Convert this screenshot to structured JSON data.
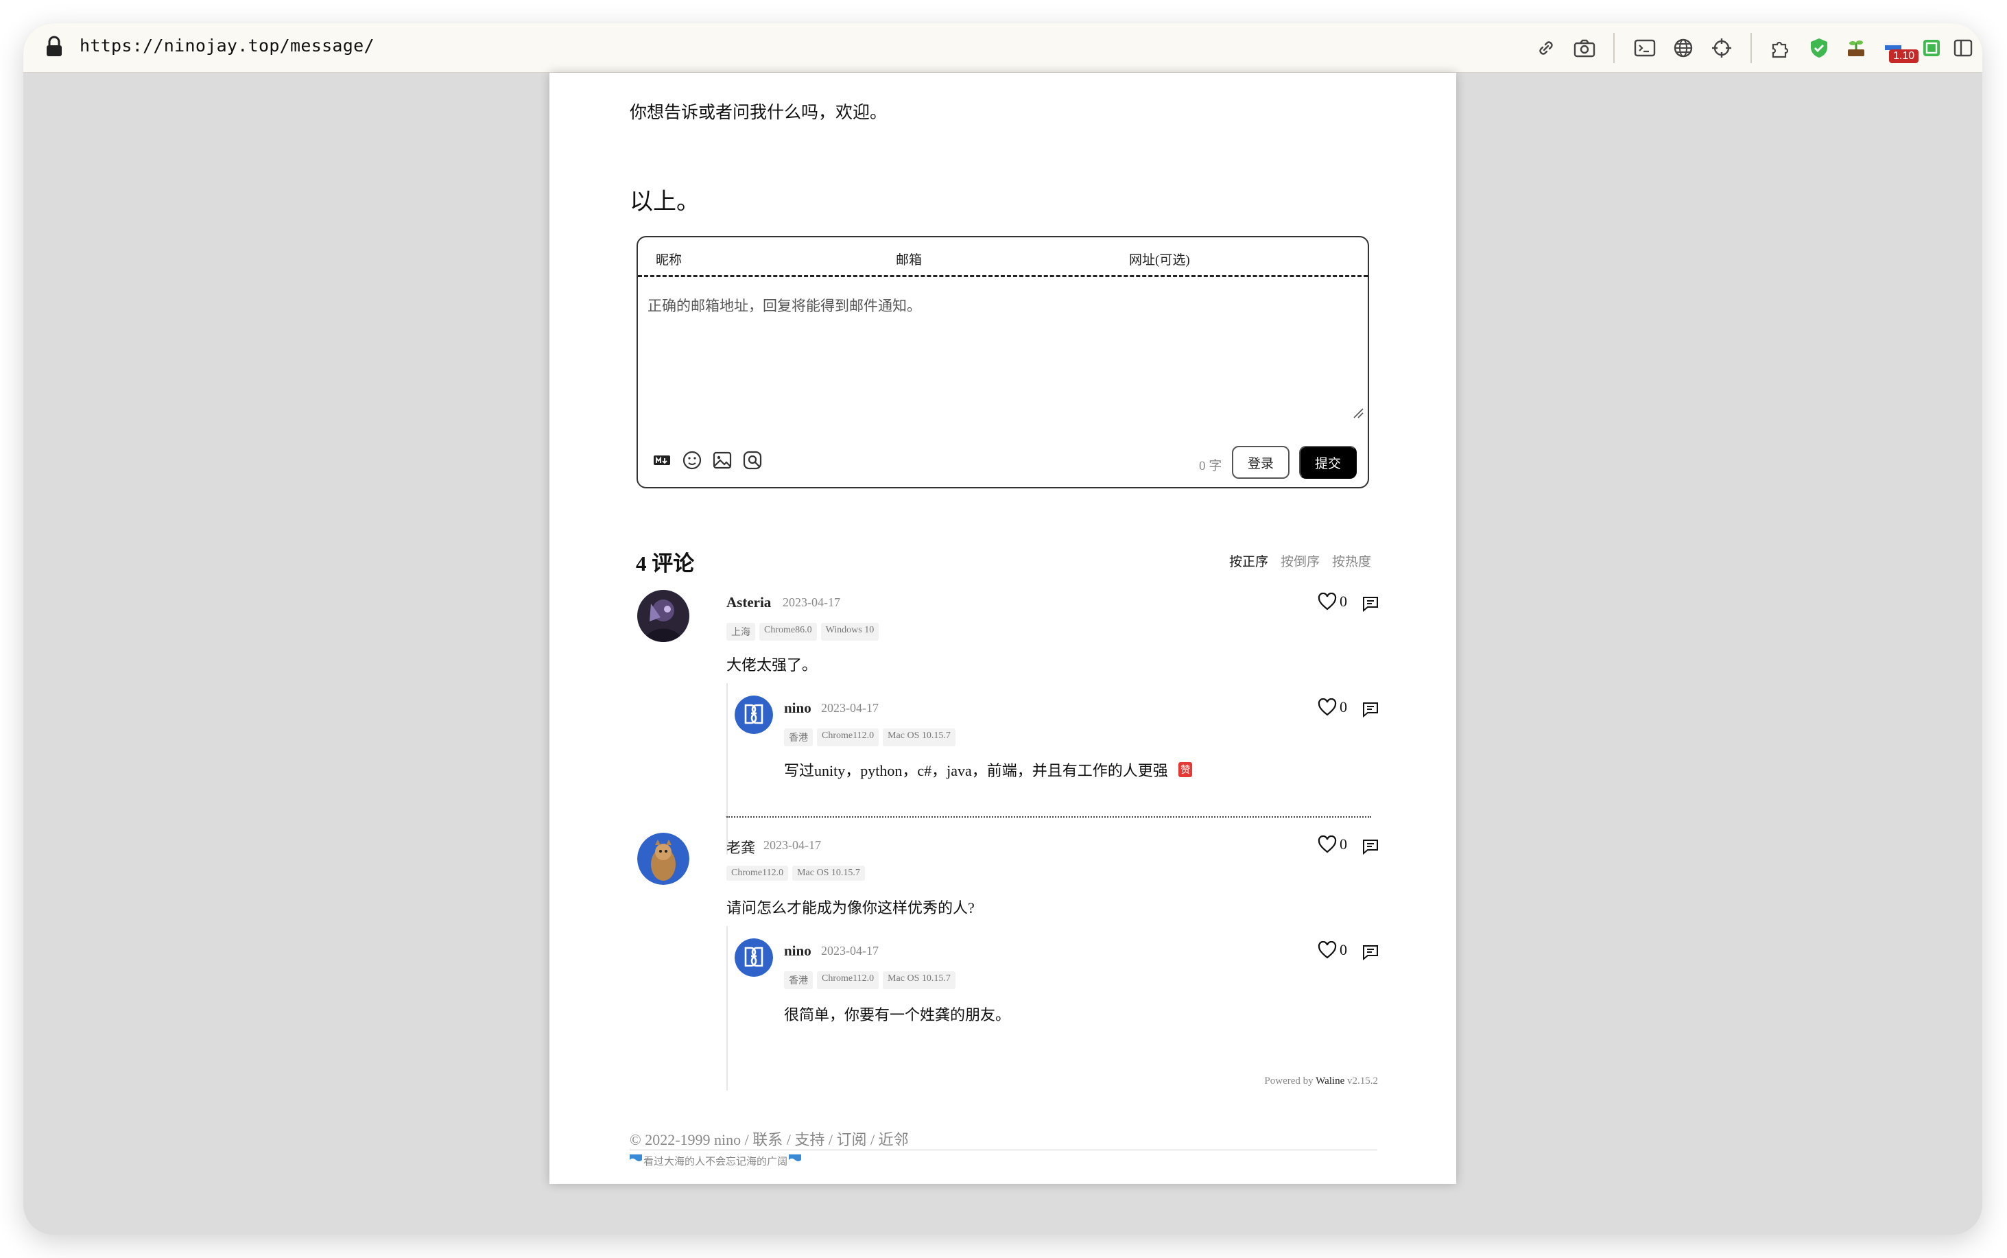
{
  "browser": {
    "url": "https://ninojay.top/message/",
    "extension_badge": "1.10"
  },
  "page": {
    "intro": "你想告诉或者问我什么吗，欢迎。",
    "heading": "以上。"
  },
  "comment_form": {
    "nick_label": "昵称",
    "mail_label": "邮箱",
    "link_label": "网址(可选)",
    "textarea_placeholder": "正确的邮箱地址，回复将能得到邮件通知。",
    "word_count": "0 字",
    "login_button": "登录",
    "submit_button": "提交"
  },
  "comments_header": {
    "count": "4 评论",
    "sort_options": [
      "按正序",
      "按倒序",
      "按热度"
    ],
    "active_sort": "按正序"
  },
  "comments": [
    {
      "nick": "Asteria",
      "date": "2023-04-17",
      "metas": [
        "上海",
        "Chrome86.0",
        "Windows 10"
      ],
      "text": "大佬太强了。",
      "likes": "0",
      "replies": [
        {
          "nick": "nino",
          "date": "2023-04-17",
          "metas": [
            "香港",
            "Chrome112.0",
            "Mac OS 10.15.7"
          ],
          "text": "写过unity，python，c#，java，前端，并且有工作的人更强",
          "emoji": "赞",
          "likes": "0"
        }
      ]
    },
    {
      "nick": "老龚",
      "date": "2023-04-17",
      "metas": [
        "Chrome112.0",
        "Mac OS 10.15.7"
      ],
      "text": "请问怎么才能成为像你这样优秀的人?",
      "likes": "0",
      "replies": [
        {
          "nick": "nino",
          "date": "2023-04-17",
          "metas": [
            "香港",
            "Chrome112.0",
            "Mac OS 10.15.7"
          ],
          "text": "很简单，你要有一个姓龚的朋友。",
          "likes": "0"
        }
      ]
    }
  ],
  "powered": {
    "prefix": "Powered by",
    "name": "Waline",
    "version": "v2.15.2"
  },
  "footer": {
    "text": "© 2022-1999 nino / 联系 / 支持 / 订阅 / 近邻",
    "tagline": "看过大海的人不会忘记海的广阔"
  },
  "colors": {
    "window_bg": "#dcdcdc",
    "toolbar_bg": "#fbf9f3",
    "submit_bg": "#000000",
    "nino_avatar": "#2f63c9"
  }
}
